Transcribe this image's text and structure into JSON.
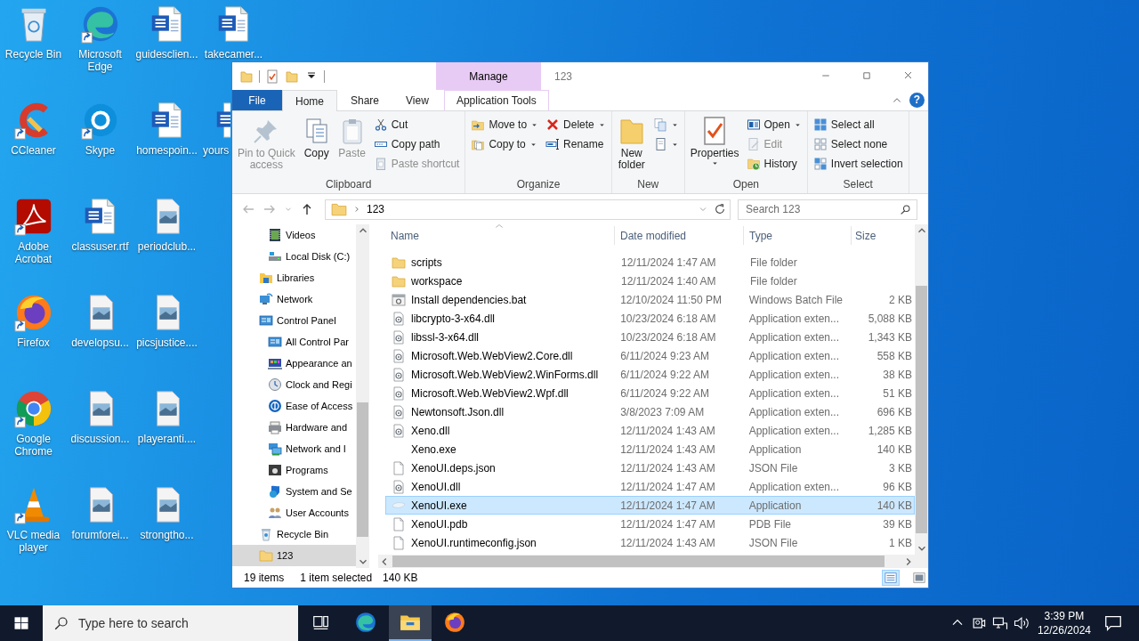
{
  "desktop": {
    "icons": [
      {
        "label": "Recycle Bin",
        "kind": "recycle",
        "shortcut": false
      },
      {
        "label": "CCleaner",
        "kind": "ccleaner",
        "shortcut": true
      },
      {
        "label": "Adobe Acrobat",
        "kind": "acrobat",
        "shortcut": true
      },
      {
        "label": "Firefox",
        "kind": "firefox",
        "shortcut": true
      },
      {
        "label": "Google Chrome",
        "kind": "chrome",
        "shortcut": true
      },
      {
        "label": "VLC media player",
        "kind": "vlc",
        "shortcut": true
      },
      {
        "label": "Microsoft Edge",
        "kind": "edge",
        "shortcut": true
      },
      {
        "label": "Skype",
        "kind": "skype",
        "shortcut": true
      },
      {
        "label": "classuser.rtf",
        "kind": "word",
        "shortcut": false
      },
      {
        "label": "developsu...",
        "kind": "image",
        "shortcut": false
      },
      {
        "label": "discussion...",
        "kind": "image",
        "shortcut": false
      },
      {
        "label": "forumforei...",
        "kind": "image",
        "shortcut": false
      },
      {
        "label": "guidesclien...",
        "kind": "word",
        "shortcut": false
      },
      {
        "label": "homespoin...",
        "kind": "word",
        "shortcut": false
      },
      {
        "label": "periodclub...",
        "kind": "image",
        "shortcut": false
      },
      {
        "label": "picsjustice....",
        "kind": "image",
        "shortcut": false
      },
      {
        "label": "playeranti....",
        "kind": "image",
        "shortcut": false
      },
      {
        "label": "strongtho...",
        "kind": "image",
        "shortcut": false
      },
      {
        "label": "takecamer...",
        "kind": "word",
        "shortcut": false
      },
      {
        "label": "yours",
        "kind": "word",
        "shortcut": false
      }
    ]
  },
  "explorer": {
    "title": "123",
    "contextual_header": "Manage",
    "help": "?",
    "tabs": [
      {
        "label": "File",
        "kind": "file",
        "selected": false
      },
      {
        "label": "Home",
        "kind": "normal",
        "selected": true
      },
      {
        "label": "Share",
        "kind": "normal",
        "selected": false
      },
      {
        "label": "View",
        "kind": "normal",
        "selected": false
      },
      {
        "label": "Application Tools",
        "kind": "contextual",
        "selected": false
      }
    ],
    "ribbon": {
      "groups": [
        {
          "label": "Clipboard",
          "items": [
            {
              "kind": "large",
              "label": "Pin to Quick\naccess",
              "disabled": true,
              "menu": false
            },
            {
              "kind": "large",
              "label": "Copy",
              "disabled": false,
              "menu": false
            },
            {
              "kind": "large",
              "label": "Paste",
              "disabled": true,
              "menu": false
            },
            {
              "kind": "stack",
              "commands": [
                {
                  "label": "Cut",
                  "disabled": false,
                  "menu": false
                },
                {
                  "label": "Copy path",
                  "disabled": false,
                  "menu": false
                },
                {
                  "label": "Paste shortcut",
                  "disabled": true,
                  "menu": false
                }
              ]
            }
          ]
        },
        {
          "label": "Organize",
          "items": [
            {
              "kind": "stack",
              "commands": [
                {
                  "label": "Move to",
                  "disabled": false,
                  "menu": true
                },
                {
                  "label": "Copy to",
                  "disabled": false,
                  "menu": true
                }
              ]
            },
            {
              "kind": "stack",
              "commands": [
                {
                  "label": "Delete",
                  "disabled": false,
                  "menu": true
                },
                {
                  "label": "Rename",
                  "disabled": false,
                  "menu": false
                }
              ]
            }
          ]
        },
        {
          "label": "New",
          "items": [
            {
              "kind": "large",
              "label": "New\nfolder",
              "disabled": false,
              "menu": false
            },
            {
              "kind": "stack",
              "commands": [
                {
                  "disabled": false,
                  "menu": true
                },
                {
                  "disabled": false,
                  "menu": true
                }
              ]
            }
          ]
        },
        {
          "label": "Open",
          "items": [
            {
              "kind": "large",
              "label": "Properties",
              "disabled": false,
              "menu": true
            },
            {
              "kind": "stack",
              "commands": [
                {
                  "label": "Open",
                  "disabled": false,
                  "menu": true
                },
                {
                  "label": "Edit",
                  "disabled": true,
                  "menu": false
                },
                {
                  "label": "History",
                  "disabled": false,
                  "menu": false
                }
              ]
            }
          ]
        },
        {
          "label": "Select",
          "items": [
            {
              "kind": "stack",
              "commands": [
                {
                  "label": "Select all",
                  "disabled": false,
                  "menu": false
                },
                {
                  "label": "Select none",
                  "disabled": false,
                  "menu": false
                },
                {
                  "label": "Invert selection",
                  "disabled": false,
                  "menu": false
                }
              ]
            }
          ]
        }
      ]
    },
    "address": {
      "path": "123",
      "search_placeholder": "Search 123"
    },
    "nav": {
      "items": [
        {
          "children": [
            {
              "label": "Videos",
              "kind": "videos",
              "selected": false
            },
            {
              "label": "Local Disk (C:)",
              "kind": "drive",
              "selected": false
            }
          ]
        },
        {
          "label": "Libraries",
          "kind": "libraries",
          "selected": false
        },
        {
          "label": "Network",
          "kind": "network",
          "selected": false
        },
        {
          "label": "Control Panel",
          "kind": "control",
          "selected": false,
          "children": [
            {
              "label": "All Control Par",
              "kind": "control",
              "selected": false
            },
            {
              "label": "Appearance an",
              "kind": "appearance",
              "selected": false
            },
            {
              "label": "Clock and Regi",
              "kind": "clock",
              "selected": false
            },
            {
              "label": "Ease of Access",
              "kind": "ease",
              "selected": false
            },
            {
              "label": "Hardware and",
              "kind": "hardware",
              "selected": false
            },
            {
              "label": "Network and I",
              "kind": "netcenter",
              "selected": false
            },
            {
              "label": "Programs",
              "kind": "programs",
              "selected": false
            },
            {
              "label": "System and Se",
              "kind": "system",
              "selected": false
            },
            {
              "label": "User Accounts",
              "kind": "users",
              "selected": false
            }
          ]
        },
        {
          "label": "Recycle Bin",
          "kind": "recycle",
          "selected": false
        },
        {
          "label": "123",
          "kind": "folder",
          "selected": true
        }
      ]
    },
    "files": {
      "columns": [
        "Name",
        "Date modified",
        "Type",
        "Size"
      ],
      "rows": [
        {
          "name": "scripts",
          "date": "12/11/2024 1:47 AM",
          "type": "File folder",
          "kind": "folder",
          "selected": false
        },
        {
          "name": "workspace",
          "date": "12/11/2024 1:40 AM",
          "type": "File folder",
          "kind": "folder",
          "selected": false
        },
        {
          "name": "Install dependencies.bat",
          "date": "12/10/2024 11:50 PM",
          "type": "Windows Batch File",
          "size": "2 KB",
          "kind": "bat",
          "selected": false
        },
        {
          "name": "libcrypto-3-x64.dll",
          "date": "10/23/2024 6:18 AM",
          "type": "Application exten...",
          "size": "5,088 KB",
          "kind": "dll",
          "selected": false
        },
        {
          "name": "libssl-3-x64.dll",
          "date": "10/23/2024 6:18 AM",
          "type": "Application exten...",
          "size": "1,343 KB",
          "kind": "dll",
          "selected": false
        },
        {
          "name": "Microsoft.Web.WebView2.Core.dll",
          "date": "6/11/2024 9:23 AM",
          "type": "Application exten...",
          "size": "558 KB",
          "kind": "dll",
          "selected": false
        },
        {
          "name": "Microsoft.Web.WebView2.WinForms.dll",
          "date": "6/11/2024 9:22 AM",
          "type": "Application exten...",
          "size": "38 KB",
          "kind": "dll",
          "selected": false
        },
        {
          "name": "Microsoft.Web.WebView2.Wpf.dll",
          "date": "6/11/2024 9:22 AM",
          "type": "Application exten...",
          "size": "51 KB",
          "kind": "dll",
          "selected": false
        },
        {
          "name": "Newtonsoft.Json.dll",
          "date": "3/8/2023 7:09 AM",
          "type": "Application exten...",
          "size": "696 KB",
          "kind": "dll",
          "selected": false
        },
        {
          "name": "Xeno.dll",
          "date": "12/11/2024 1:43 AM",
          "type": "Application exten...",
          "size": "1,285 KB",
          "kind": "dll",
          "selected": false
        },
        {
          "name": "Xeno.exe",
          "date": "12/11/2024 1:43 AM",
          "type": "Application",
          "size": "140 KB",
          "kind": "blank",
          "selected": false
        },
        {
          "name": "XenoUI.deps.json",
          "date": "12/11/2024 1:43 AM",
          "type": "JSON File",
          "size": "3 KB",
          "kind": "page",
          "selected": false
        },
        {
          "name": "XenoUI.dll",
          "date": "12/11/2024 1:47 AM",
          "type": "Application exten...",
          "size": "96 KB",
          "kind": "dll",
          "selected": false
        },
        {
          "name": "XenoUI.exe",
          "date": "12/11/2024 1:47 AM",
          "type": "Application",
          "size": "140 KB",
          "kind": "exe",
          "selected": true
        },
        {
          "name": "XenoUI.pdb",
          "date": "12/11/2024 1:47 AM",
          "type": "PDB File",
          "size": "39 KB",
          "kind": "page",
          "selected": false
        },
        {
          "name": "XenoUI.runtimeconfig.json",
          "date": "12/11/2024 1:43 AM",
          "type": "JSON File",
          "size": "1 KB",
          "kind": "page",
          "selected": false
        }
      ]
    },
    "status": {
      "count": "19 items",
      "selection": "1 item selected",
      "size": "140 KB",
      "views": [
        {
          "kind": "details",
          "selected": true
        },
        {
          "kind": "large-icons",
          "selected": false
        }
      ]
    }
  },
  "taskbar": {
    "search_placeholder": "Type here to search",
    "apps": [
      {
        "kind": "edge",
        "selected": false
      },
      {
        "kind": "explorer",
        "selected": true
      },
      {
        "kind": "firefox",
        "selected": false
      }
    ],
    "time": "3:39 PM",
    "date": "12/26/2024"
  }
}
